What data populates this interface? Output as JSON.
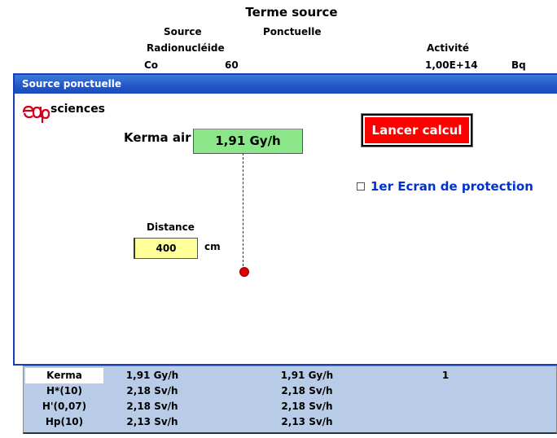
{
  "header": {
    "title": "Terme source",
    "source_label": "Source",
    "source_value": "Ponctuelle",
    "radionuclide_label": "Radionucléide",
    "activity_label": "Activité",
    "element": "Co",
    "mass_number": "60",
    "activity_value": "1,00E+14",
    "activity_unit": "Bq"
  },
  "dialog": {
    "title": "Source ponctuelle",
    "logo_text": "sciences",
    "kerma_label": "Kerma air",
    "kerma_value": "1,91 Gy/h",
    "launch_button": "Lancer calcul",
    "checkbox_label": "1er Ecran de protection",
    "checkbox_checked": false,
    "distance_label": "Distance",
    "distance_value": "400",
    "distance_unit": "cm"
  },
  "results": [
    {
      "label": "Kerma",
      "v1": "1,91 Gy/h",
      "v2": "1,91 Gy/h",
      "v3": "1"
    },
    {
      "label": "H*(10)",
      "v1": "2,18 Sv/h",
      "v2": "2,18 Sv/h",
      "v3": ""
    },
    {
      "label": "H'(0,07)",
      "v1": "2,18 Sv/h",
      "v2": "2,18 Sv/h",
      "v3": ""
    },
    {
      "label": "Hp(10)",
      "v1": "2,13 Sv/h",
      "v2": "2,13 Sv/h",
      "v3": ""
    }
  ],
  "colors": {
    "titlebar": "#2356c8",
    "kerma_box": "#8ce68a",
    "launch_button": "#ff0000",
    "distance_box": "#ffff99",
    "results_bg": "#b8cce8",
    "checkbox_label": "#0033cc"
  }
}
